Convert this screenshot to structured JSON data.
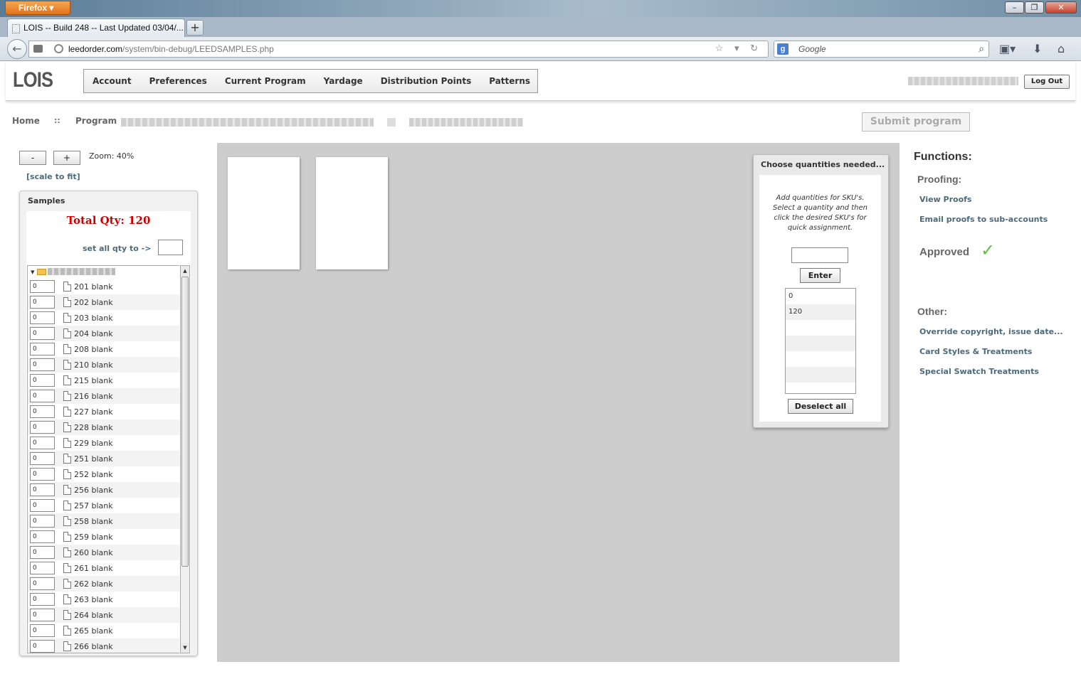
{
  "browser": {
    "app_button": "Firefox",
    "tab_title": "LOIS -- Build 248 -- Last Updated 03/04/...",
    "new_tab": "+",
    "url_host": "leedorder.com",
    "url_path": "/system/bin-debug/LEEDSAMPLES.php",
    "search_placeholder": "Google",
    "window_controls": [
      "–",
      "❐",
      "✕"
    ]
  },
  "header": {
    "logo": "LOIS",
    "nav": [
      "Account",
      "Preferences",
      "Current Program",
      "Yardage",
      "Distribution Points",
      "Patterns"
    ],
    "logout": "Log Out"
  },
  "breadcrumb": {
    "home": "Home",
    "separator": "::",
    "program": "Program"
  },
  "submit_label": "Submit program",
  "zoom": {
    "minus": "-",
    "plus": "+",
    "label": "Zoom: 40%",
    "scale_to_fit": "[scale to fit]"
  },
  "samples": {
    "title": "Samples",
    "total": "Total Qty: 120",
    "set_all_label": "set all qty to ->",
    "items": [
      {
        "qty": "0",
        "label": "201 blank"
      },
      {
        "qty": "0",
        "label": "202 blank"
      },
      {
        "qty": "0",
        "label": "203 blank"
      },
      {
        "qty": "0",
        "label": "204 blank"
      },
      {
        "qty": "0",
        "label": "208 blank"
      },
      {
        "qty": "0",
        "label": "210 blank"
      },
      {
        "qty": "0",
        "label": "215 blank"
      },
      {
        "qty": "0",
        "label": "216 blank"
      },
      {
        "qty": "0",
        "label": "227 blank"
      },
      {
        "qty": "0",
        "label": "228 blank"
      },
      {
        "qty": "0",
        "label": "229 blank"
      },
      {
        "qty": "0",
        "label": "251 blank"
      },
      {
        "qty": "0",
        "label": "252 blank"
      },
      {
        "qty": "0",
        "label": "256 blank"
      },
      {
        "qty": "0",
        "label": "257 blank"
      },
      {
        "qty": "0",
        "label": "258 blank"
      },
      {
        "qty": "0",
        "label": "259 blank"
      },
      {
        "qty": "0",
        "label": "260 blank"
      },
      {
        "qty": "0",
        "label": "261 blank"
      },
      {
        "qty": "0",
        "label": "262 blank"
      },
      {
        "qty": "0",
        "label": "263 blank"
      },
      {
        "qty": "0",
        "label": "264 blank"
      },
      {
        "qty": "0",
        "label": "265 blank"
      },
      {
        "qty": "0",
        "label": "266 blank"
      }
    ]
  },
  "quantities_panel": {
    "title": "Choose quantities needed...",
    "instructions": "Add quantities for SKU's. Select a quantity and then click the desired SKU's for quick assignment.",
    "enter": "Enter",
    "list": [
      "0",
      "120",
      "",
      "",
      "",
      "",
      ""
    ],
    "deselect": "Deselect all"
  },
  "functions": {
    "title": "Functions:",
    "proofing": "Proofing:",
    "view_proofs": "View Proofs",
    "email_proofs": "Email proofs to sub-accounts",
    "approved": "Approved",
    "other": "Other:",
    "override": "Override copyright, issue date...",
    "card_styles": "Card Styles & Treatments",
    "special": "Special Swatch Treatments"
  },
  "colors": {
    "total_qty": "#cc0000",
    "link": "#4d6a7a",
    "approved_check": "#5fbf3a",
    "canvas": "#cdcdcd"
  }
}
